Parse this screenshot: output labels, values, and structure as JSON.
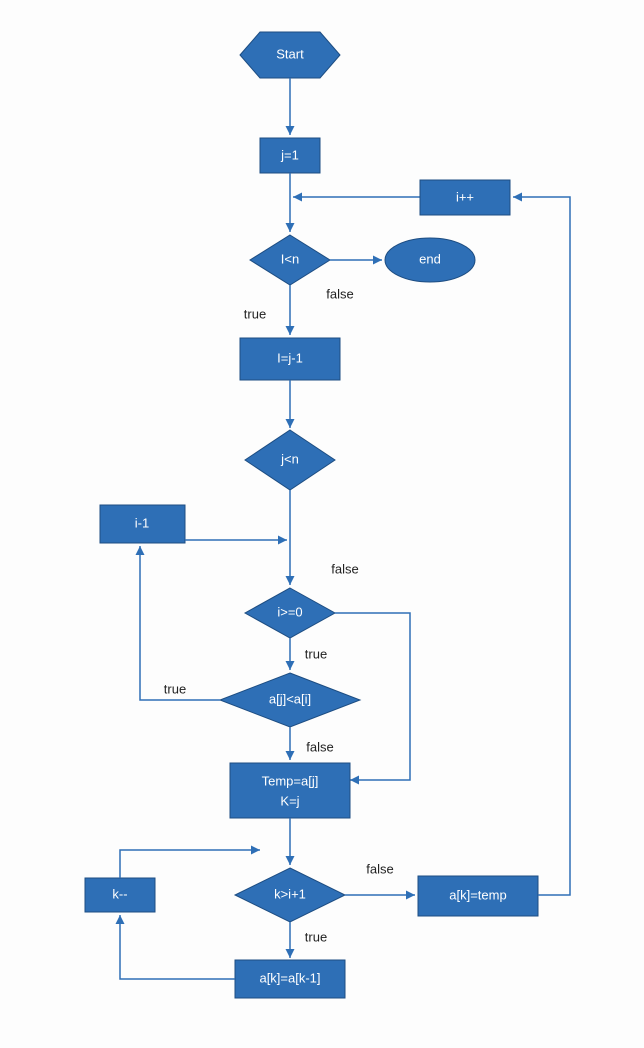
{
  "diagram": {
    "type": "flowchart",
    "nodes": {
      "start": "Start",
      "init_j": "j=1",
      "inc_i": "i++",
      "cond_I_lt_n": "I<n",
      "end": "end",
      "assign_I": "I=j-1",
      "cond_j_lt_n": "j<n",
      "i_minus_1": "i-1",
      "cond_i_ge_0": "i>=0",
      "cond_aj_lt_ai": "a[j]<a[i]",
      "temp_assign_line1": "Temp=a[j]",
      "temp_assign_line2": "K=j",
      "cond_k_gt_ip1": "k>i+1",
      "ak_temp": "a[k]=temp",
      "k_dec": "k--",
      "ak_shift": "a[k]=a[k-1]"
    },
    "edge_labels": {
      "true": "true",
      "false": "false"
    }
  }
}
